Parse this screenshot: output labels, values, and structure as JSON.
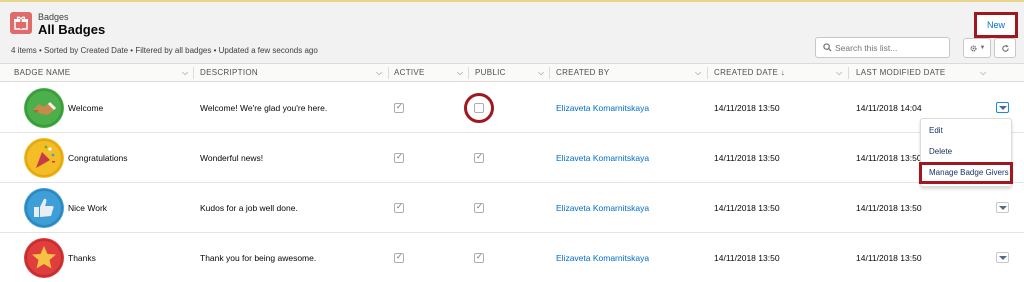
{
  "header": {
    "object_label": "Badges",
    "list_title": "All Badges",
    "meta": "4 items • Sorted by Created Date • Filtered by all badges • Updated a few seconds ago",
    "new_label": "New",
    "search_placeholder": "Search this list..."
  },
  "columns": [
    {
      "label": "BADGE NAME"
    },
    {
      "label": "DESCRIPTION"
    },
    {
      "label": "ACTIVE"
    },
    {
      "label": "PUBLIC"
    },
    {
      "label": "CREATED BY"
    },
    {
      "label": "CREATED DATE ↓"
    },
    {
      "label": "LAST MODIFIED DATE"
    }
  ],
  "rows": [
    {
      "name": "Welcome",
      "description": "Welcome! We're glad you're here.",
      "active": true,
      "public": false,
      "created_by": "Elizaveta Komarnitskaya",
      "created_date": "14/11/2018 13:50",
      "modified_date": "14/11/2018 14:04",
      "icon": "handshake-icon",
      "color": "#4bb04b"
    },
    {
      "name": "Congratulations",
      "description": "Wonderful news!",
      "active": true,
      "public": true,
      "created_by": "Elizaveta Komarnitskaya",
      "created_date": "14/11/2018 13:50",
      "modified_date": "14/11/2018 13:50",
      "icon": "party-popper-icon",
      "color": "#f4bc25"
    },
    {
      "name": "Nice Work",
      "description": "Kudos for a job well done.",
      "active": true,
      "public": true,
      "created_by": "Elizaveta Komarnitskaya",
      "created_date": "14/11/2018 13:50",
      "modified_date": "14/11/2018 13:50",
      "icon": "thumbs-up-icon",
      "color": "#3e9fd8"
    },
    {
      "name": "Thanks",
      "description": "Thank you for being awesome.",
      "active": true,
      "public": true,
      "created_by": "Elizaveta Komarnitskaya",
      "created_date": "14/11/2018 13:50",
      "modified_date": "14/11/2018 13:50",
      "icon": "star-icon",
      "color": "#e03e3e"
    }
  ],
  "menu": {
    "items": [
      {
        "label": "Edit"
      },
      {
        "label": "Delete"
      },
      {
        "label": "Manage Badge Givers"
      }
    ]
  },
  "colors": {
    "link": "#006dcc",
    "highlight_outline": "#a0171e",
    "header_bg": "#f3f2f2"
  }
}
